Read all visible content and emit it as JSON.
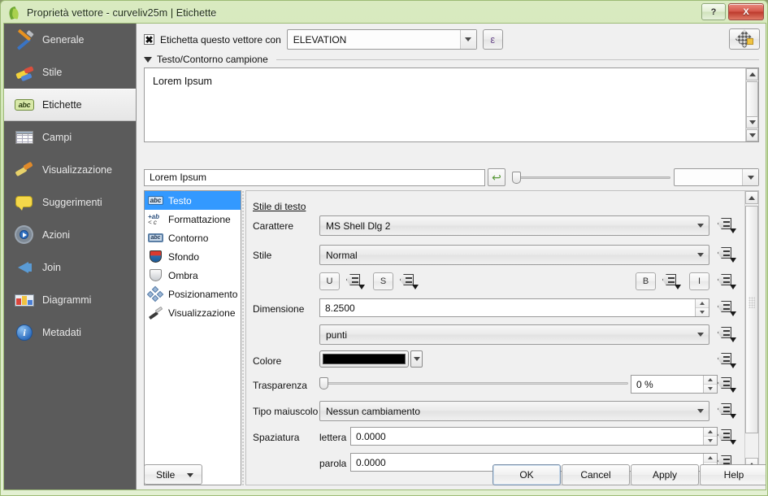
{
  "window": {
    "title": "Proprietà vettore - curveliv25m | Etichette",
    "app_icon": "qgis-leaf-icon",
    "controls": {
      "help": "?",
      "close": "X"
    }
  },
  "sidebar": {
    "items": [
      {
        "label": "Generale",
        "icon": "tools-icon",
        "selected": false
      },
      {
        "label": "Stile",
        "icon": "paint-icon",
        "selected": false
      },
      {
        "label": "Etichette",
        "icon": "abc-label-icon",
        "selected": true
      },
      {
        "label": "Campi",
        "icon": "table-icon",
        "selected": false
      },
      {
        "label": "Visualizzazione",
        "icon": "brush-icon",
        "selected": false
      },
      {
        "label": "Suggerimenti",
        "icon": "speech-bubble-icon",
        "selected": false
      },
      {
        "label": "Azioni",
        "icon": "gear-play-icon",
        "selected": false
      },
      {
        "label": "Join",
        "icon": "join-arrow-icon",
        "selected": false
      },
      {
        "label": "Diagrammi",
        "icon": "chart-image-icon",
        "selected": false
      },
      {
        "label": "Metadati",
        "icon": "info-circle-icon",
        "selected": false
      }
    ]
  },
  "header": {
    "checkbox_checked": true,
    "checkbox_glyph": "✖",
    "label_with_text": "Etichetta questo vettore con",
    "field_value": "ELEVATION",
    "expression_button": "ε",
    "topright_icon": "checkerboard-settings-icon"
  },
  "group": {
    "title": "Testo/Contorno campione",
    "expanded": true
  },
  "preview": {
    "sample_text": "Lorem Ipsum"
  },
  "sample_row": {
    "input_value": "Lorem Ipsum",
    "reset_icon": "↩",
    "zoom_combo_value": ""
  },
  "tree": {
    "items": [
      {
        "label": "Testo",
        "icon": "abc-text-icon",
        "selected": true
      },
      {
        "label": "Formattazione",
        "icon": "format-icon",
        "selected": false
      },
      {
        "label": "Contorno",
        "icon": "abc-outline-icon",
        "selected": false
      },
      {
        "label": "Sfondo",
        "icon": "shield-fill-icon",
        "selected": false
      },
      {
        "label": "Ombra",
        "icon": "shield-shadow-icon",
        "selected": false
      },
      {
        "label": "Posizionamento",
        "icon": "move-diamond-icon",
        "selected": false
      },
      {
        "label": "Visualizzazione",
        "icon": "brush-icon",
        "selected": false
      }
    ]
  },
  "form": {
    "section_title": "Stile di testo",
    "rows": {
      "font": {
        "label": "Carattere",
        "value": "MS Shell Dlg 2"
      },
      "style": {
        "label": "Stile",
        "value": "Normal"
      },
      "size": {
        "label": "Dimensione",
        "value": "8.2500"
      },
      "units": {
        "value": "punti"
      },
      "color": {
        "label": "Colore",
        "value": "#000000"
      },
      "transparency": {
        "label": "Trasparenza",
        "value": "0 %",
        "slider_percent": 0
      },
      "capitalize": {
        "label": "Tipo maiuscolo",
        "value": "Nessun cambiamento"
      },
      "spacing": {
        "label": "Spaziatura",
        "letter_label": "lettera",
        "letter_value": "0.0000",
        "word_label": "parola",
        "word_value": "0.0000"
      }
    },
    "format_buttons": {
      "underline": "U",
      "strikethrough": "S",
      "bold": "B",
      "italic": "I"
    },
    "data_defined_icon": "data-defined-override-icon"
  },
  "footer": {
    "style_button": "Stile",
    "ok": "OK",
    "cancel": "Cancel",
    "apply": "Apply",
    "help": "Help"
  },
  "colors": {
    "titlebar_green": "#cfe4b4",
    "nav_background": "#5b5b5b",
    "selection_blue": "#3399ff",
    "text_color": "#000000",
    "close_red": "#bb3a2c"
  }
}
